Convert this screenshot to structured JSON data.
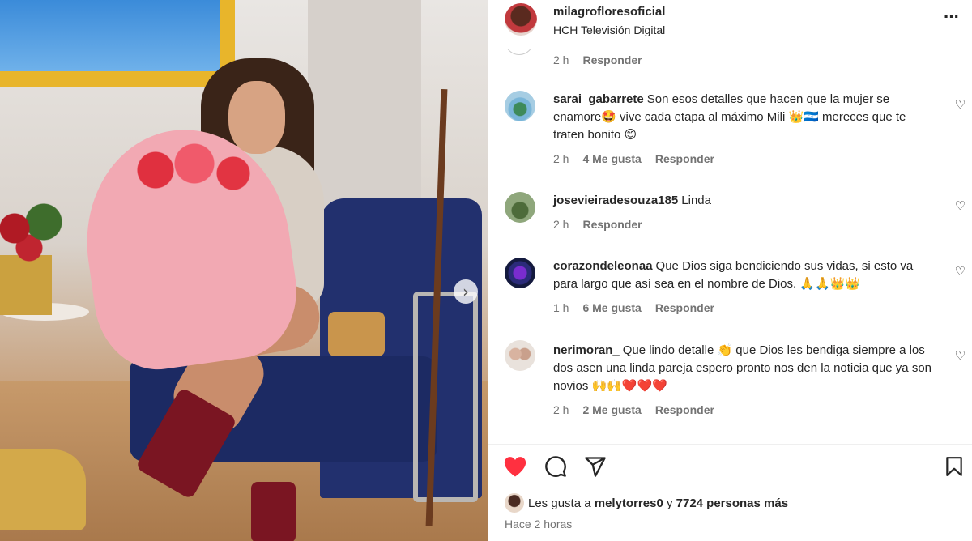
{
  "post": {
    "author": "milagrofloresoficial",
    "subtitle": "HCH Televisión Digital",
    "more_icon": "···"
  },
  "top_stub": {
    "time": "2 h",
    "reply": "Responder"
  },
  "comments": [
    {
      "user": "sarai_gabarrete",
      "text": "Son esos detalles que hacen que la mujer se enamore🤩 vive cada etapa al máximo Mili 👑🇭🇳 mereces que te traten bonito 😊",
      "time": "2 h",
      "likes": "4 Me gusta",
      "reply": "Responder"
    },
    {
      "user": "josevieiradesouza185",
      "text": "Linda",
      "time": "2 h",
      "likes": "",
      "reply": "Responder"
    },
    {
      "user": "corazondeleonaa",
      "text": "Que Dios siga bendiciendo sus vidas, si esto va para largo que así sea en el nombre de Dios. 🙏🙏👑👑",
      "time": "1 h",
      "likes": "6 Me gusta",
      "reply": "Responder"
    },
    {
      "user": "nerimoran_",
      "text": "Que lindo detalle 👏 que Dios les bendiga siempre a los dos asen una linda pareja espero pronto nos den la noticia que ya son novios 🙌🙌❤️❤️❤️",
      "time": "2 h",
      "likes": "2 Me gusta",
      "reply": "Responder"
    }
  ],
  "actions": {
    "like_icon": "heart-filled",
    "comment_icon": "comment",
    "share_icon": "share",
    "save_icon": "bookmark"
  },
  "likes": {
    "prefix": "Les gusta a",
    "user": "melytorres0",
    "joiner": "y",
    "others": "7724 personas más"
  },
  "posted": "Hace 2 horas",
  "colors": {
    "like_red": "#ff3040",
    "text": "#262626",
    "muted": "#737373"
  }
}
